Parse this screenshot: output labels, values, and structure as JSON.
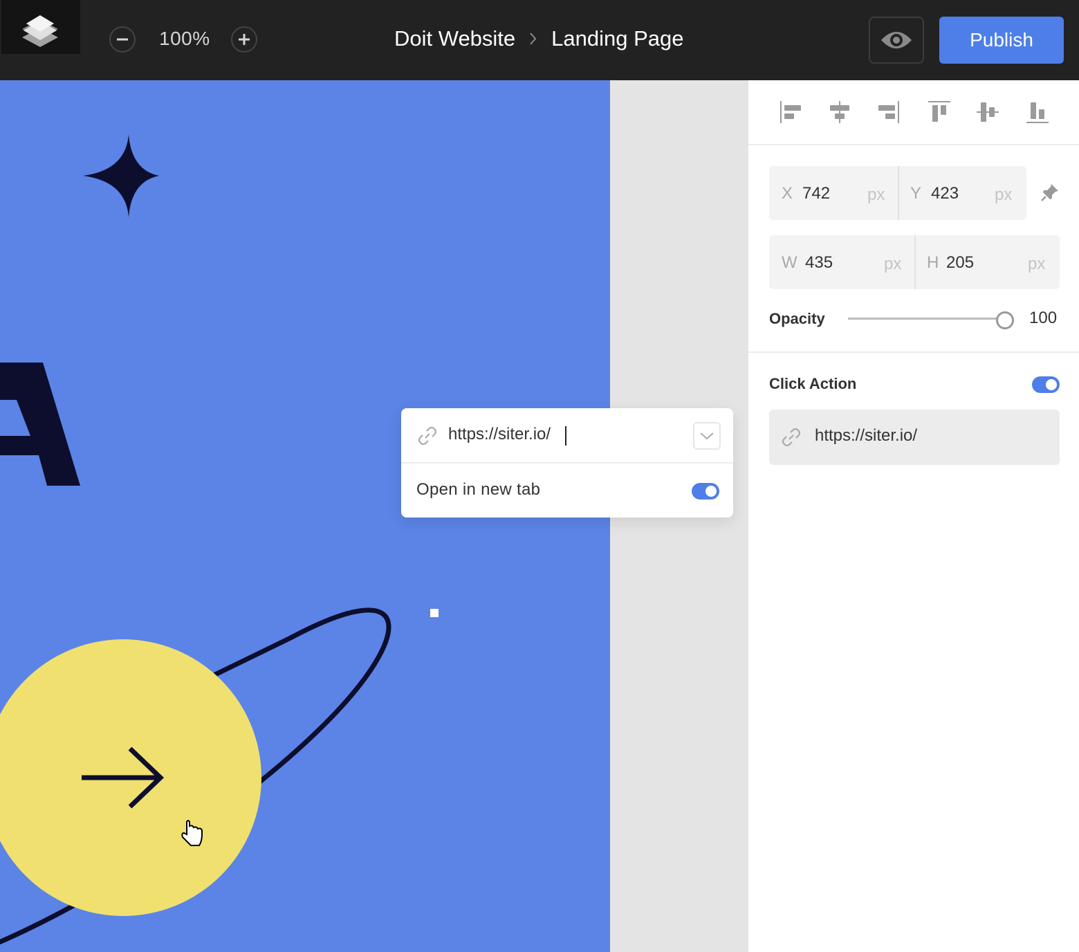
{
  "toolbar": {
    "zoom": "100%",
    "breadcrumb": [
      "Doit Website",
      "Landing Page"
    ],
    "publish_label": "Publish",
    "icons": [
      "app-logo-icon",
      "zoom-out-icon",
      "zoom-in-icon",
      "chevron-right-icon",
      "eye-icon"
    ]
  },
  "canvas": {
    "background": "#5b84e6",
    "partial_letter": "A",
    "circle_color": "#f0e070"
  },
  "link_popover": {
    "url_value": "https://siter.io/",
    "open_new_tab_label": "Open in new tab",
    "open_new_tab": true
  },
  "panel": {
    "align_icons": [
      "align-left-icon",
      "align-center-horizontal-icon",
      "align-right-icon",
      "align-top-icon",
      "align-center-vertical-icon",
      "align-bottom-icon"
    ],
    "position": {
      "x_label": "X",
      "x_value": "742",
      "y_label": "Y",
      "y_value": "423",
      "w_label": "W",
      "w_value": "435",
      "h_label": "H",
      "h_value": "205",
      "unit": "px"
    },
    "opacity_label": "Opacity",
    "opacity_value": "100",
    "opacity_level": 1.0,
    "click_action_label": "Click Action",
    "click_action_enabled": true,
    "click_action_url": "https://siter.io/"
  },
  "colors": {
    "accent": "#4e7fe8",
    "topbar": "#222222"
  }
}
